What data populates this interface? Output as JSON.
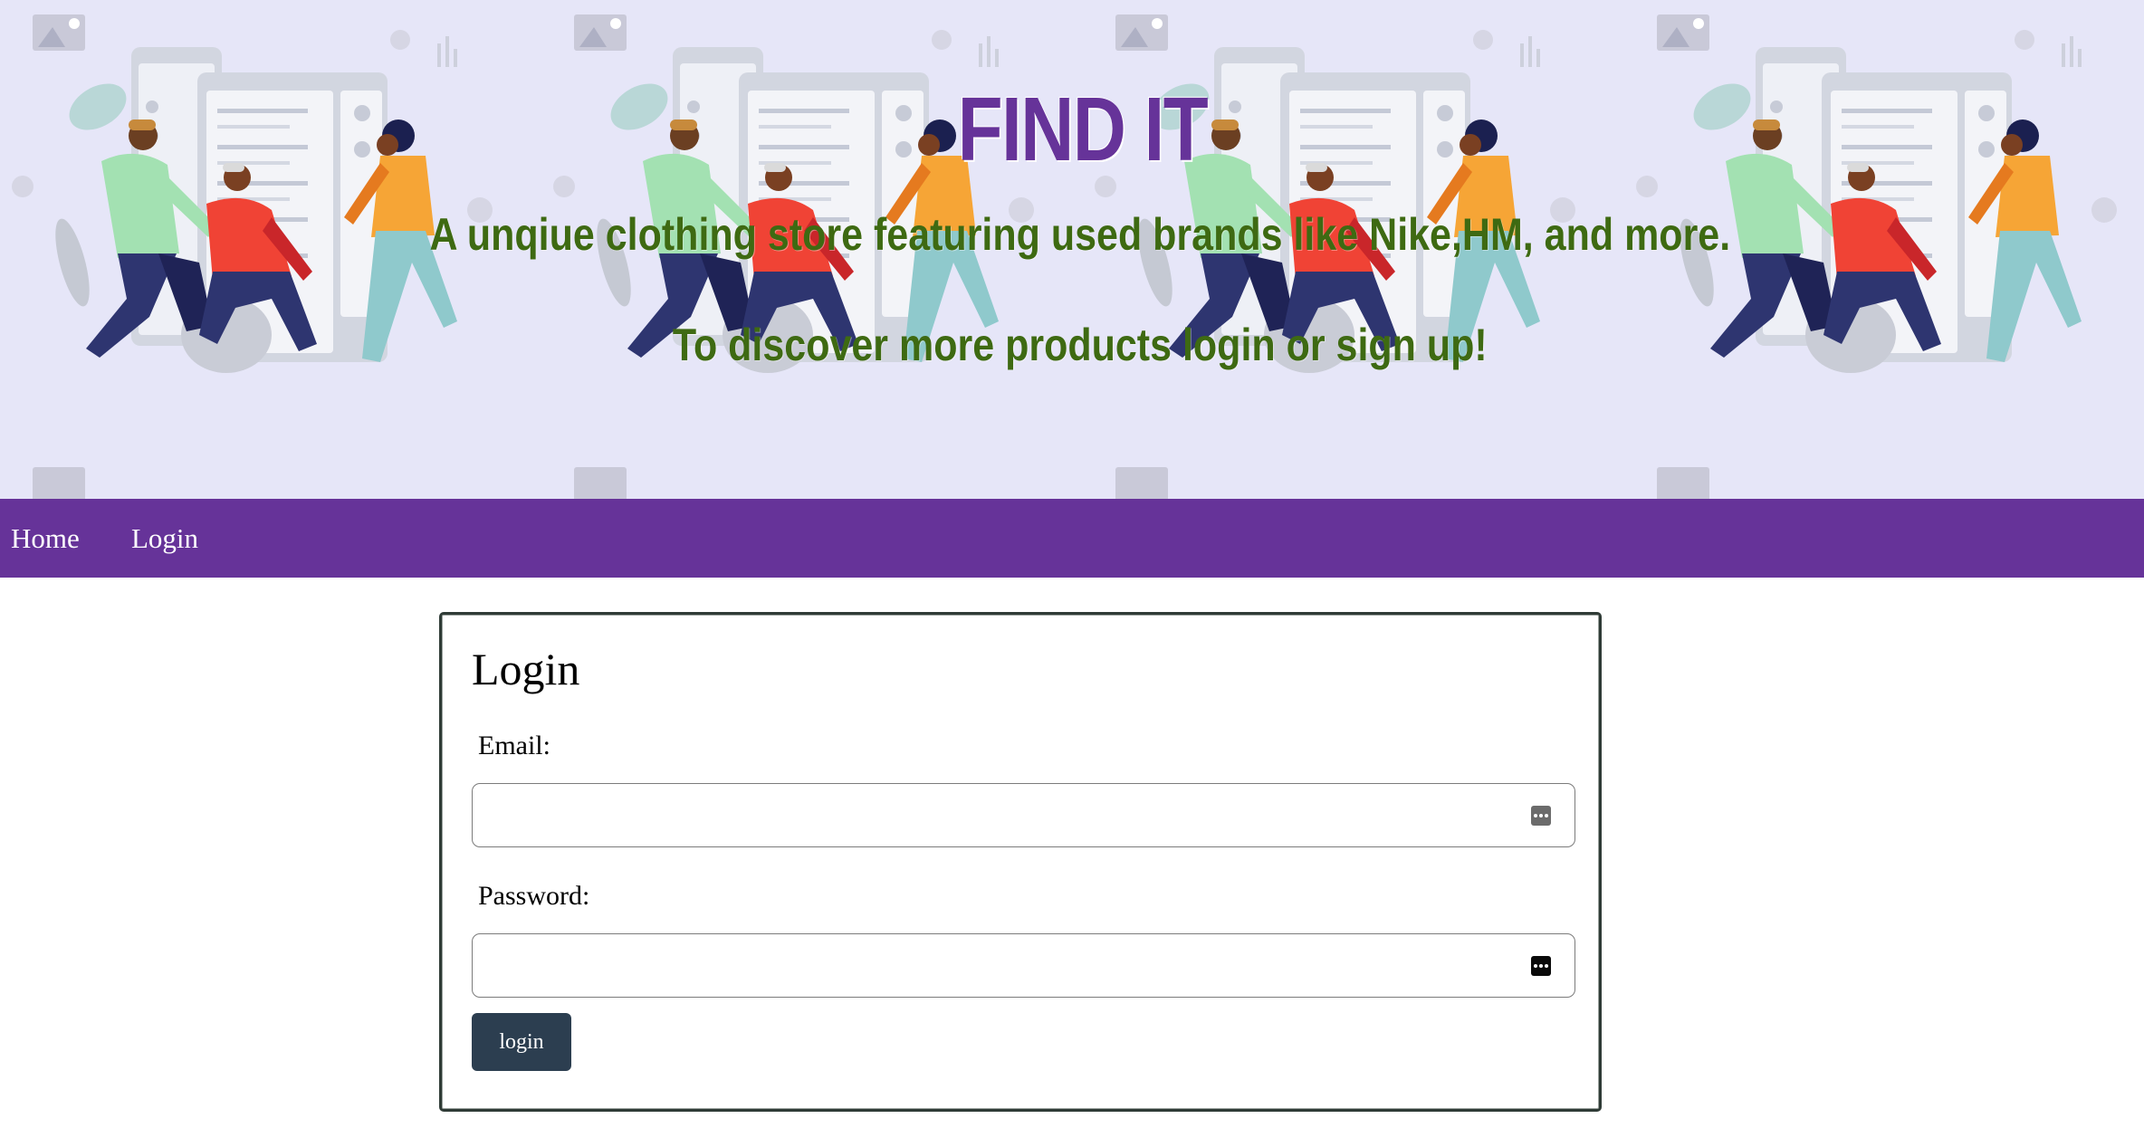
{
  "hero": {
    "title": "FIND IT",
    "tagline": "A unqiue clothing store featuring used brands like Nike,HM, and more.",
    "cta": "To discover more products login or sign up!",
    "title_color": "#663399",
    "text_color": "#3e6a12",
    "background_color": "#e6e6f8"
  },
  "nav": {
    "background_color": "#663399",
    "items": [
      {
        "label": "Home"
      },
      {
        "label": "Login"
      }
    ]
  },
  "login_form": {
    "title": "Login",
    "email_label": "Email:",
    "email_value": "",
    "password_label": "Password:",
    "password_value": "",
    "autofill_icon": "password-key-icon",
    "submit_label": "login",
    "button_color": "#2c3e50"
  }
}
